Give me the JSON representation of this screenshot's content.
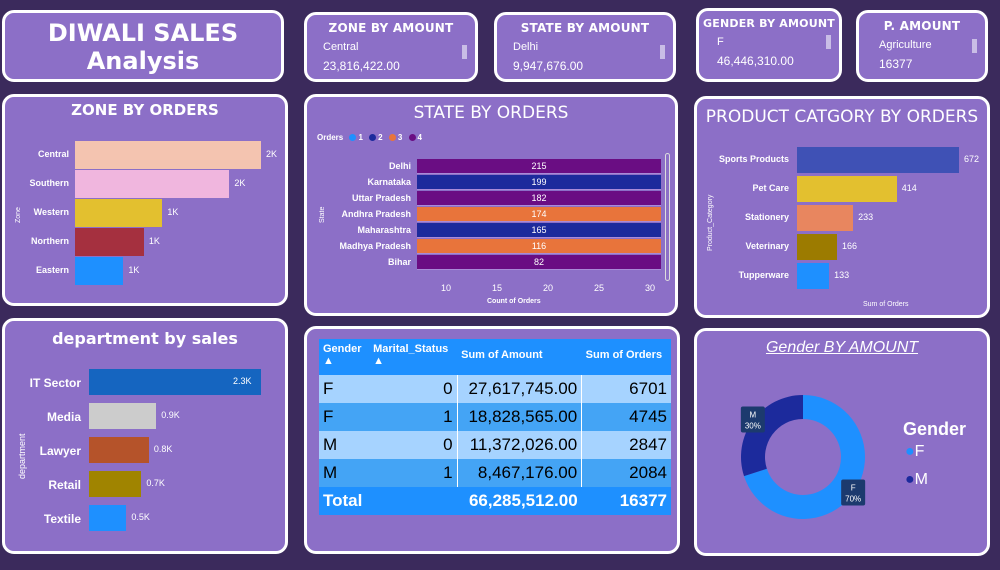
{
  "title": {
    "line1": "DIWALI SALES",
    "line2": "Analysis"
  },
  "kpis": [
    {
      "title": "ZONE BY AMOUNT",
      "sub": "Central",
      "value": "23,816,422.00"
    },
    {
      "title": "STATE BY AMOUNT",
      "sub": "Delhi",
      "value": "9,947,676.00"
    },
    {
      "title": "GENDER BY AMOUNT",
      "sub": "F",
      "value": "46,446,310.00"
    },
    {
      "title": "P. AMOUNT",
      "sub": "Agriculture",
      "value": "16377"
    }
  ],
  "colors": {
    "accent": "#1e90ff",
    "card": "#8c6fc7",
    "background": "#3b2a5c",
    "purple": "#6a0d83",
    "navy": "#1c2a9c",
    "orange": "#e8743b"
  },
  "chart_data": [
    {
      "id": "zone",
      "type": "bar",
      "title": "ZONE BY ORDERS",
      "ylabel": "Zone",
      "categories": [
        "Central",
        "Southern",
        "Western",
        "Northern",
        "Eastern"
      ],
      "values": [
        2,
        2,
        1,
        1,
        1
      ],
      "data_labels": [
        "2K",
        "2K",
        "1K",
        "1K",
        "1K"
      ],
      "rel": [
        1.0,
        0.83,
        0.47,
        0.37,
        0.26
      ],
      "colors": [
        "#f4c4b0",
        "#f0b6de",
        "#e3c02f",
        "#a5303f",
        "#1e90ff"
      ]
    },
    {
      "id": "state",
      "type": "bar",
      "title": "STATE BY ORDERS",
      "legend_title": "Orders",
      "legend": [
        "1",
        "2",
        "3",
        "4"
      ],
      "legend_colors": [
        "#1e90ff",
        "#1c2a9c",
        "#e8743b",
        "#6a0d83"
      ],
      "ylabel": "State",
      "xlabel": "Count of Orders",
      "xticks": [
        "10",
        "15",
        "20",
        "25",
        "30"
      ],
      "categories": [
        "Delhi",
        "Karnataka",
        "Uttar Pradesh",
        "Andhra Pradesh",
        "Maharashtra",
        "Madhya Pradesh",
        "Bihar"
      ],
      "values": [
        215,
        199,
        182,
        174,
        165,
        116,
        82
      ],
      "colors": [
        "#6a0d83",
        "#1c2a9c",
        "#6a0d83",
        "#e8743b",
        "#1c2a9c",
        "#e8743b",
        "#6a0d83"
      ]
    },
    {
      "id": "product",
      "type": "bar",
      "title": "PRODUCT CATGORY BY ORDERS",
      "ylabel": "Product_Category",
      "xlabel": "Sum of Orders",
      "categories": [
        "Sports Products",
        "Pet Care",
        "Stationery",
        "Veterinary",
        "Tupperware"
      ],
      "values": [
        672,
        414,
        233,
        166,
        133
      ],
      "colors": [
        "#3f51b5",
        "#e3c02f",
        "#e8865f",
        "#9c7b00",
        "#1e90ff"
      ]
    },
    {
      "id": "dept",
      "type": "bar",
      "title": "department by sales",
      "ylabel": "department",
      "categories": [
        "IT Sector",
        "Media",
        "Lawyer",
        "Retail",
        "Textile"
      ],
      "values": [
        2.3,
        0.9,
        0.8,
        0.7,
        0.5
      ],
      "data_labels": [
        "2.3K",
        "0.9K",
        "0.8K",
        "0.7K",
        "0.5K"
      ],
      "colors": [
        "#1565c0",
        "#cccccc",
        "#b5532a",
        "#a08400",
        "#1e90ff"
      ]
    },
    {
      "id": "gender",
      "type": "pie",
      "title": "Gender BY AMOUNT",
      "legend_title": "Gender",
      "categories": [
        "F",
        "M"
      ],
      "values": [
        70,
        30
      ],
      "data_labels": [
        "70%",
        "30%"
      ],
      "colors": [
        "#1e90ff",
        "#1c2a9c"
      ]
    }
  ],
  "table": {
    "headers": [
      "Gender",
      "Marital_Status",
      "Sum of Amount",
      "Sum of Orders"
    ],
    "rows": [
      [
        "F",
        "0",
        "27,617,745.00",
        "6701"
      ],
      [
        "F",
        "1",
        "18,828,565.00",
        "4745"
      ],
      [
        "M",
        "0",
        "11,372,026.00",
        "2847"
      ],
      [
        "M",
        "1",
        "8,467,176.00",
        "2084"
      ]
    ],
    "total": {
      "label": "Total",
      "amount": "66,285,512.00",
      "orders": "16377"
    }
  }
}
